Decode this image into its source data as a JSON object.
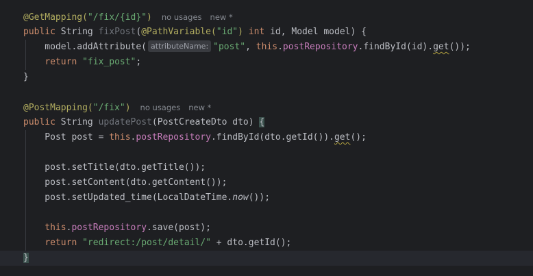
{
  "editor": {
    "lines": [
      {
        "tokens": [
          {
            "t": "@GetMapping(",
            "c": "ann"
          },
          {
            "t": "\"/fix/{id}\"",
            "c": "str"
          },
          {
            "t": ")",
            "c": "ann"
          }
        ],
        "meta": [
          "no usages",
          "new *"
        ]
      },
      {
        "tokens": [
          {
            "t": "public",
            "c": "kw"
          },
          {
            "t": " String "
          },
          {
            "t": "fixPost",
            "c": "fn-dim"
          },
          {
            "t": "("
          },
          {
            "t": "@PathVariable(",
            "c": "ann"
          },
          {
            "t": "\"id\"",
            "c": "str"
          },
          {
            "t": ")",
            "c": "ann"
          },
          {
            "t": " "
          },
          {
            "t": "int",
            "c": "kw"
          },
          {
            "t": " id, Model model) {"
          }
        ]
      },
      {
        "tokens": [
          {
            "t": "    model.addAttribute("
          },
          {
            "hint": "attributeName:"
          },
          {
            "t": "\"post\"",
            "c": "str"
          },
          {
            "t": ", "
          },
          {
            "t": "this",
            "c": "kw"
          },
          {
            "t": "."
          },
          {
            "t": "postRepository",
            "c": "fld"
          },
          {
            "t": ".findById(id)."
          },
          {
            "t": "get",
            "c": "warn"
          },
          {
            "t": "());"
          }
        ]
      },
      {
        "tokens": [
          {
            "t": "    "
          },
          {
            "t": "return",
            "c": "kw"
          },
          {
            "t": " "
          },
          {
            "t": "\"fix_post\"",
            "c": "str"
          },
          {
            "t": ";"
          }
        ]
      },
      {
        "tokens": [
          {
            "t": "}"
          }
        ]
      },
      {
        "tokens": []
      },
      {
        "tokens": [
          {
            "t": "@PostMapping(",
            "c": "ann"
          },
          {
            "t": "\"/fix\"",
            "c": "str"
          },
          {
            "t": ")",
            "c": "ann"
          }
        ],
        "meta": [
          "no usages",
          "new *"
        ]
      },
      {
        "tokens": [
          {
            "t": "public",
            "c": "kw"
          },
          {
            "t": " String "
          },
          {
            "t": "updatePost",
            "c": "fn-dim"
          },
          {
            "t": "(PostCreateDto dto) "
          },
          {
            "t": "{",
            "c": "brace-hl"
          }
        ]
      },
      {
        "tokens": [
          {
            "t": "    Post post = "
          },
          {
            "t": "this",
            "c": "kw"
          },
          {
            "t": "."
          },
          {
            "t": "postRepository",
            "c": "fld"
          },
          {
            "t": ".findById(dto.getId())."
          },
          {
            "t": "get",
            "c": "warn"
          },
          {
            "t": "();"
          }
        ]
      },
      {
        "tokens": []
      },
      {
        "tokens": [
          {
            "t": "    post.setTitle(dto.getTitle());"
          }
        ]
      },
      {
        "tokens": [
          {
            "t": "    post.setContent(dto.getContent());"
          }
        ]
      },
      {
        "tokens": [
          {
            "t": "    post.setUpdated_time(LocalDateTime."
          },
          {
            "t": "now",
            "c": "ital"
          },
          {
            "t": "());"
          }
        ]
      },
      {
        "tokens": []
      },
      {
        "tokens": [
          {
            "t": "    "
          },
          {
            "t": "this",
            "c": "kw"
          },
          {
            "t": "."
          },
          {
            "t": "postRepository",
            "c": "fld"
          },
          {
            "t": ".save(post);"
          }
        ]
      },
      {
        "tokens": [
          {
            "t": "    "
          },
          {
            "t": "return",
            "c": "kw"
          },
          {
            "t": " "
          },
          {
            "t": "\"redirect:/post/detail/\"",
            "c": "str"
          },
          {
            "t": " + dto.getId();"
          }
        ]
      },
      {
        "tokens": [
          {
            "t": "}",
            "c": "brace-hl"
          }
        ],
        "current": true
      }
    ],
    "gutter_icon": "lightbulb-icon",
    "colors": {
      "background": "#1e1f22",
      "keyword": "#cf8e6d",
      "string": "#6aab73",
      "annotation": "#b3ae60",
      "field": "#c77dbb"
    }
  }
}
